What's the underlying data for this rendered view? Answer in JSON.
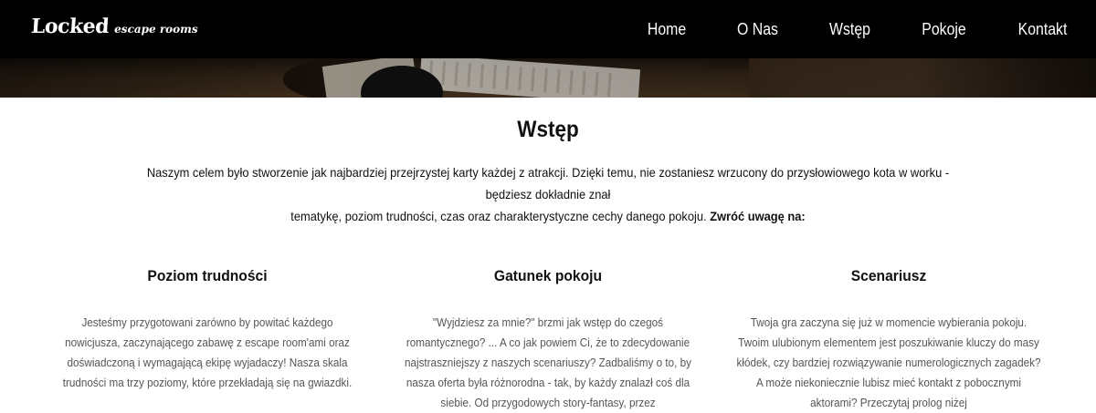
{
  "logo": {
    "main": "Locked",
    "sub": "escape rooms"
  },
  "nav": {
    "items": [
      "Home",
      "O Nas",
      "Wstęp",
      "Pokoje",
      "Kontakt"
    ]
  },
  "section": {
    "title": "Wstęp",
    "intro_line1": "Naszym celem było stworzenie jak najbardziej przejrzystej karty każdej z atrakcji. Dzięki temu, nie zostaniesz wrzucony do przysłowiowego kota w worku - będziesz dokładnie znał",
    "intro_line2": "tematykę, poziom trudności, czas oraz charakterystyczne cechy danego pokoju. ",
    "intro_emphasis": "Zwróć uwagę na:"
  },
  "columns": [
    {
      "title": "Poziom trudności",
      "text": "Jesteśmy przygotowani zarówno by powitać każdego nowicjusza, zaczynającego zabawę z escape room'ami oraz doświadczoną i wymagającą ekipę wyjadaczy! Nasza skala trudności ma trzy poziomy, które przekładają się na gwiazdki."
    },
    {
      "title": "Gatunek pokoju",
      "text": "\"Wyjdziesz za mnie?\" brzmi jak wstęp do czegoś romantycznego? ... A co jak powiem Ci, że to zdecydowanie najstraszniejszy z naszych scenariuszy? Zadbaliśmy o to, by nasza oferta była różnorodna - tak, by każdy znalazł coś dla siebie. Od przygodowych story-fantasy, przez"
    },
    {
      "title": "Scenariusz",
      "text": "Twoja gra zaczyna się już w momencie wybierania pokoju. Twoim ulubionym elementem jest poszukiwanie kluczy do masy kłódek, czy bardziej rozwiązywanie numerologicznych zagadek? A może niekoniecznie lubisz mieć kontakt z pobocznymi aktorami? Przeczytaj prolog niżej"
    }
  ]
}
